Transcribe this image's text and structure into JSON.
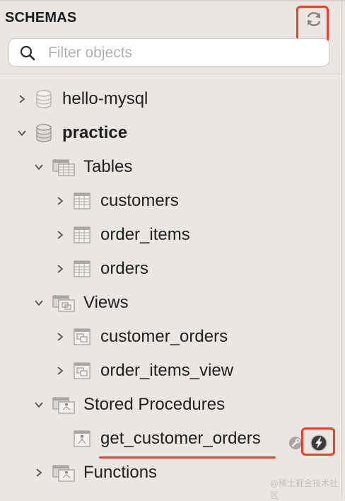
{
  "panel": {
    "title": "SCHEMAS"
  },
  "search": {
    "placeholder": "Filter objects",
    "value": ""
  },
  "tree": {
    "schema_hello": "hello-mysql",
    "schema_practice": "practice",
    "tables_group": "Tables",
    "tables": [
      "customers",
      "order_items",
      "orders"
    ],
    "views_group": "Views",
    "views": [
      "customer_orders",
      "order_items_view"
    ],
    "procedures_group": "Stored Procedures",
    "procedures": [
      "get_customer_orders"
    ],
    "functions_group": "Functions"
  },
  "watermark": "@稀土掘金技术社区",
  "colors": {
    "highlight": "#e8412a",
    "background": "#e9e6e3",
    "search_bg": "#ffffff"
  },
  "icons": {
    "refresh": "refresh-icon",
    "search": "search-icon",
    "database": "database-icon",
    "table": "table-icon",
    "view": "view-icon",
    "procedure": "procedure-icon",
    "wrench": "wrench-icon",
    "execute": "lightning-icon"
  }
}
